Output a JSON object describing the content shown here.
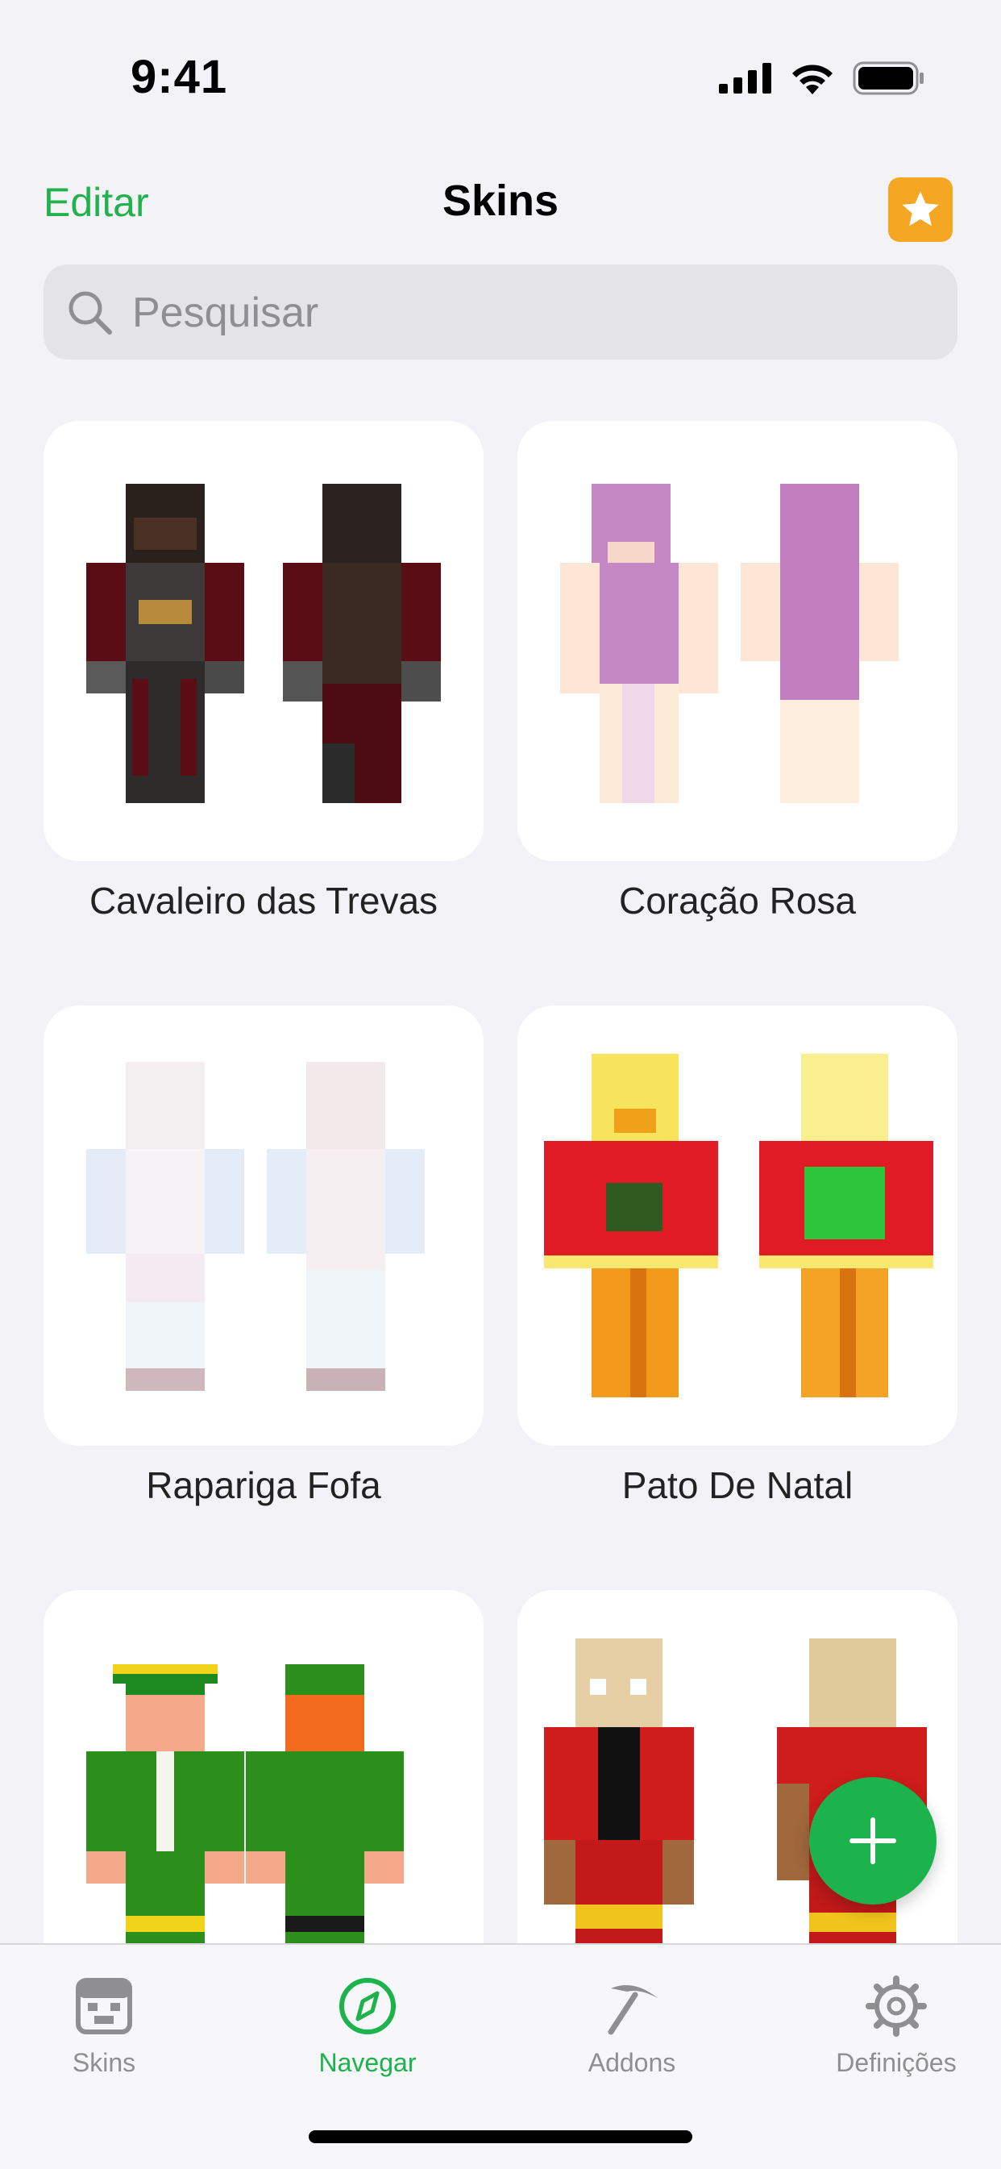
{
  "status_bar": {
    "time": "9:41"
  },
  "nav": {
    "edit_label": "Editar",
    "title": "Skins",
    "favorite_icon": "star-icon"
  },
  "search": {
    "placeholder": "Pesquisar",
    "value": ""
  },
  "skins": [
    {
      "name": "Cavaleiro das Trevas"
    },
    {
      "name": "Coração Rosa"
    },
    {
      "name": "Rapariga Fofa"
    },
    {
      "name": "Pato De Natal"
    },
    {
      "name": ""
    },
    {
      "name": ""
    }
  ],
  "fab": {
    "icon": "plus-icon"
  },
  "tabbar": {
    "tabs": [
      {
        "label": "Skins",
        "icon": "skin-face-icon"
      },
      {
        "label": "Navegar",
        "icon": "compass-icon",
        "active": true
      },
      {
        "label": "Addons",
        "icon": "pickaxe-icon"
      },
      {
        "label": "Definições",
        "icon": "gear-icon"
      }
    ]
  },
  "colors": {
    "accent": "#1db34c",
    "favorite": "#f5a623",
    "background": "#f2f2f7"
  }
}
